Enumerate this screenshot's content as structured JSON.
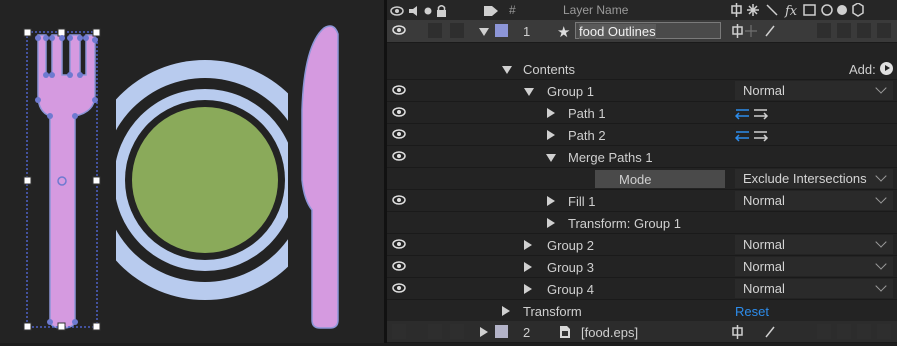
{
  "header": {
    "hash": "#",
    "layer_name": "Layer Name",
    "icons": [
      "eye-icon",
      "speaker-icon",
      "solo-dot-icon",
      "lock-icon",
      "label-icon",
      "shy-icon",
      "collapse-icon",
      "quality-icon",
      "fx-icon",
      "frame-blend-icon",
      "motion-blur-icon",
      "adjustment-icon",
      "3d-icon"
    ]
  },
  "colors": {
    "label_blue": "#8d96d8",
    "plate": "#b8cbee",
    "food": "#8aaa5a",
    "utensil": "#d59ae0",
    "accent": "#2d8ceb"
  },
  "layers": [
    {
      "num": "1",
      "name": "food Outlines"
    },
    {
      "num": "2",
      "name": "[food.eps]"
    }
  ],
  "rows": {
    "contents": "Contents",
    "add": "Add:",
    "group1": "Group 1",
    "group1_mode": "Normal",
    "path1": "Path 1",
    "path2": "Path 2",
    "merge": "Merge Paths 1",
    "mode": "Mode",
    "mode_value": "Exclude Intersections",
    "fill1": "Fill 1",
    "fill1_mode": "Normal",
    "transform_group1": "Transform: Group 1",
    "group2": "Group 2",
    "group2_mode": "Normal",
    "group3": "Group 3",
    "group3_mode": "Normal",
    "group4": "Group 4",
    "group4_mode": "Normal",
    "transform": "Transform",
    "reset": "Reset"
  }
}
